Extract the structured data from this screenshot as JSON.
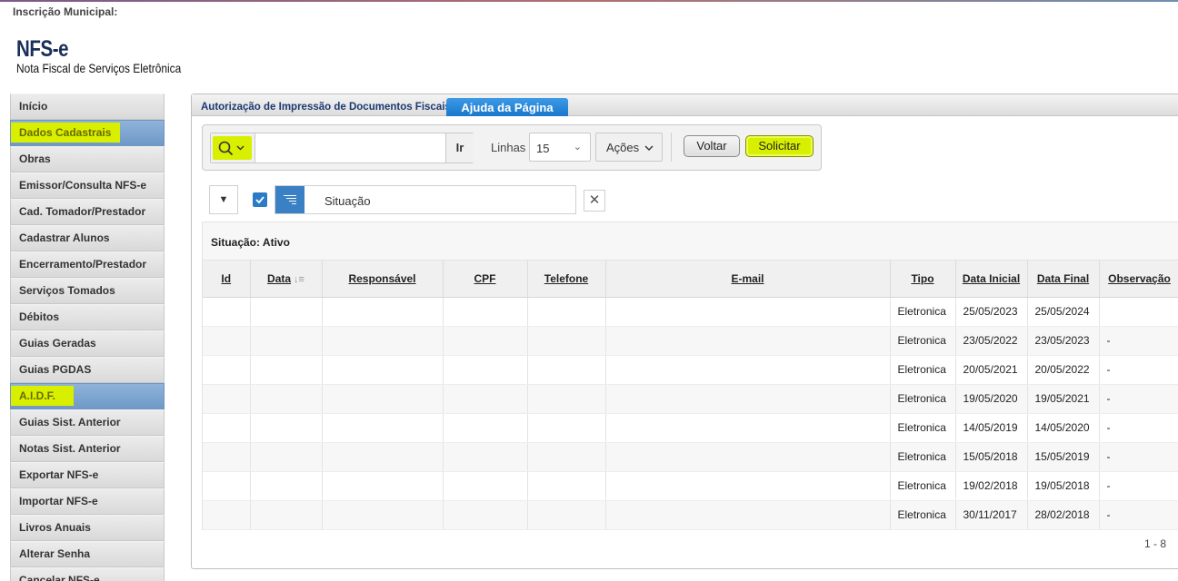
{
  "header": {
    "inscricao_label": "Inscrição Municipal:",
    "brand_title": "NFS-e",
    "brand_subtitle": "Nota Fiscal de Serviços Eletrônica"
  },
  "sidebar": {
    "items": [
      {
        "label": "Início",
        "active": false
      },
      {
        "label": "Dados Cadastrais",
        "active": true
      },
      {
        "label": "Obras",
        "active": false
      },
      {
        "label": "Emissor/Consulta NFS-e",
        "active": false
      },
      {
        "label": "Cad. Tomador/Prestador",
        "active": false
      },
      {
        "label": "Cadastrar Alunos",
        "active": false
      },
      {
        "label": "Encerramento/Prestador",
        "active": false
      },
      {
        "label": "Serviços Tomados",
        "active": false
      },
      {
        "label": "Débitos",
        "active": false
      },
      {
        "label": "Guias Geradas",
        "active": false
      },
      {
        "label": "Guias PGDAS",
        "active": false
      },
      {
        "label": "A.I.D.F.",
        "active": true
      },
      {
        "label": "Guias Sist. Anterior",
        "active": false
      },
      {
        "label": "Notas Sist. Anterior",
        "active": false
      },
      {
        "label": "Exportar NFS-e",
        "active": false
      },
      {
        "label": "Importar NFS-e",
        "active": false
      },
      {
        "label": "Livros Anuais",
        "active": false
      },
      {
        "label": "Alterar Senha",
        "active": false
      },
      {
        "label": "Cancelar NFS-e",
        "active": false
      }
    ]
  },
  "panel": {
    "title": "Autorização de Impressão de Documentos Fiscais",
    "help_tab": "Ajuda da Página"
  },
  "toolbar": {
    "search_value": "",
    "search_placeholder": "",
    "go_label": "Ir",
    "linhas_label": "Linhas",
    "linhas_value": "15",
    "acoes_label": "Ações",
    "voltar_label": "Voltar",
    "solicitar_label": "Solicitar"
  },
  "filter": {
    "text": "Situação",
    "checked": true
  },
  "report": {
    "group_label": "Situação: Ativo",
    "columns": [
      "Id",
      "Data",
      "Responsável",
      "CPF",
      "Telefone",
      "E-mail",
      "Tipo",
      "Data Inicial",
      "Data Final",
      "Observação"
    ],
    "rows": [
      [
        "",
        "",
        "",
        "",
        "",
        "",
        "Eletronica",
        "25/05/2023",
        "25/05/2024",
        ""
      ],
      [
        "",
        "",
        "",
        "",
        "",
        "",
        "Eletronica",
        "23/05/2022",
        "23/05/2023",
        "-"
      ],
      [
        "",
        "",
        "",
        "",
        "",
        "",
        "Eletronica",
        "20/05/2021",
        "20/05/2022",
        "-"
      ],
      [
        "",
        "",
        "",
        "",
        "",
        "",
        "Eletronica",
        "19/05/2020",
        "19/05/2021",
        "-"
      ],
      [
        "",
        "",
        "",
        "",
        "",
        "",
        "Eletronica",
        "14/05/2019",
        "14/05/2020",
        "-"
      ],
      [
        "",
        "",
        "",
        "",
        "",
        "",
        "Eletronica",
        "15/05/2018",
        "15/05/2019",
        "-"
      ],
      [
        "",
        "",
        "",
        "",
        "",
        "",
        "Eletronica",
        "19/02/2018",
        "19/05/2018",
        "-"
      ],
      [
        "",
        "",
        "",
        "",
        "",
        "",
        "Eletronica",
        "30/11/2017",
        "28/02/2018",
        "-"
      ]
    ],
    "pagination": "1 - 8"
  },
  "colors": {
    "highlight": "#d8f000",
    "active_menu": "#7ea6d0",
    "brand": "#1a2e5a",
    "help_tab": "#2a86d8"
  }
}
